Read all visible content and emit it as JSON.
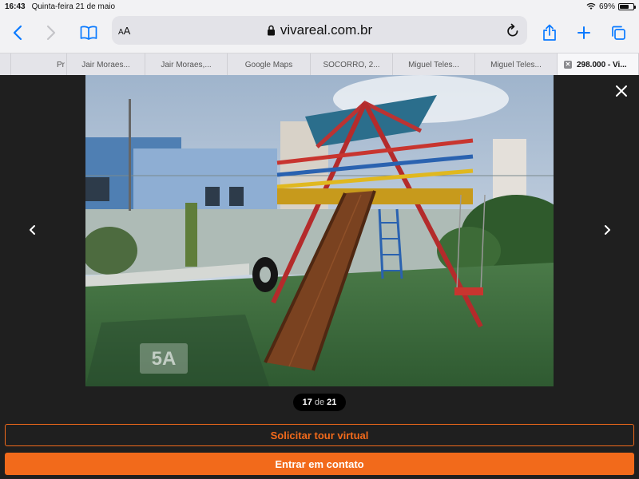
{
  "status_bar": {
    "time": "16:43",
    "date": "Quinta-feira 21 de maio",
    "battery": "69%",
    "battery_level": 0.69
  },
  "toolbar": {
    "reader_label": "AA",
    "url": "vivareal.com.br",
    "icons": [
      "back-icon",
      "forward-icon",
      "bookmarks-icon",
      "lock-icon",
      "reload-icon",
      "share-icon",
      "new-tab-icon",
      "tabs-overview-icon"
    ]
  },
  "tabs": [
    {
      "label": ""
    },
    {
      "label": "Pr"
    },
    {
      "label": "Jair Moraes..."
    },
    {
      "label": "Jair Moraes,..."
    },
    {
      "label": "Google Maps"
    },
    {
      "label": "SOCORRO, 2..."
    },
    {
      "label": "Miguel Teles..."
    },
    {
      "label": "Miguel Teles..."
    },
    {
      "label": "298.000 - Vi..."
    }
  ],
  "gallery": {
    "counter_current": "17",
    "counter_sep": "de",
    "counter_total": "21",
    "watermark": "5A"
  },
  "actions": {
    "virtual_tour": "Solicitar tour virtual",
    "contact": "Entrar em contato"
  },
  "colors": {
    "accent_orange": "#f26a1b",
    "ios_blue": "#0a7aff"
  }
}
